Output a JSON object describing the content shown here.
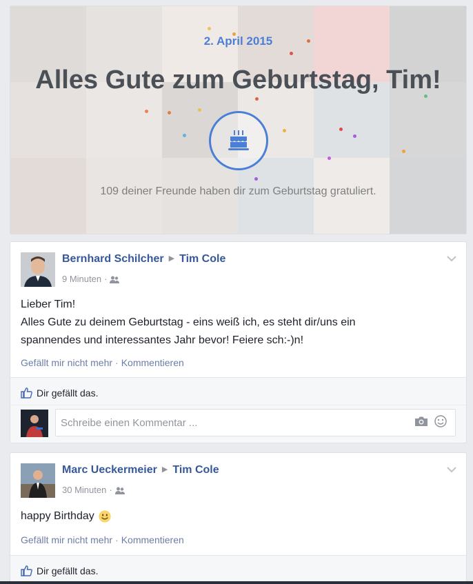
{
  "banner": {
    "date": "2. April 2015",
    "title": "Alles Gute zum Geburtstag, Tim!",
    "subtitle": "109 deiner Freunde haben dir zum Geburtstag gratuliert.",
    "accent_color": "#4b7fd6",
    "icon": "birthday-cake-icon"
  },
  "posts": [
    {
      "author": "Bernhard Schilcher",
      "target": "Tim Cole",
      "time": "9 Minuten",
      "audience_icon": "friends-icon",
      "text_lines": [
        "Lieber Tim!",
        "Alles Gute zu deinem Geburtstag - eins weiß ich, es steht dir/uns ein",
        "spannendes und interessantes Jahr bevor! Feiere sch:-)n!"
      ],
      "like_action": "Gefällt mir nicht mehr",
      "comment_action": "Kommentieren",
      "likes_text": "Dir gefällt das.",
      "comment_placeholder": "Schreibe einen Kommentar ..."
    },
    {
      "author": "Marc Ueckermeier",
      "target": "Tim Cole",
      "time": "30 Minuten",
      "audience_icon": "friends-icon",
      "text": "happy Birthday",
      "emoji": "smiley-emoji",
      "like_action": "Gefällt mir nicht mehr",
      "comment_action": "Kommentieren",
      "likes_text": "Dir gefällt das."
    }
  ],
  "colors": {
    "link": "#365899",
    "meta": "#90949c",
    "background": "#e9ebee"
  }
}
